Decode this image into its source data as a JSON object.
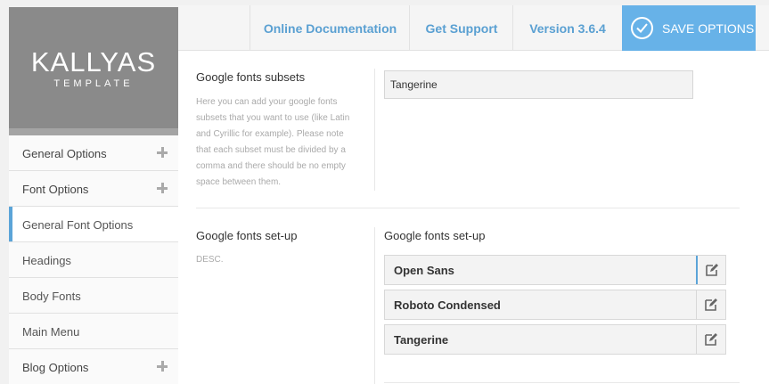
{
  "logo": {
    "title": "KALLYAS",
    "subtitle": "TEMPLATE"
  },
  "sidebar": {
    "items": [
      {
        "label": "General Options",
        "expandable": true
      },
      {
        "label": "Font Options",
        "expandable": true
      },
      {
        "label": "General Font Options",
        "active": true
      },
      {
        "label": "Headings"
      },
      {
        "label": "Body Fonts"
      },
      {
        "label": "Main Menu"
      },
      {
        "label": "Blog Options",
        "expandable": true
      }
    ]
  },
  "topbar": {
    "docs": "Online Documentation",
    "support": "Get Support",
    "version": "Version 3.6.4",
    "save": "SAVE OPTIONS"
  },
  "subsets": {
    "title": "Google fonts subsets",
    "desc_lines": [
      "Here you can add your google fonts",
      "subsets that you want to use (like Latin",
      "and Cyrillic for example). Please note",
      "that each subset must be divided by a",
      "comma and there should be no empty",
      "space between them."
    ],
    "value": "Tangerine"
  },
  "setup": {
    "title": "Google fonts set-up",
    "desc": "DESC.",
    "section_label": "Google fonts set-up",
    "fonts": [
      "Open Sans",
      "Roboto Condensed",
      "Tangerine"
    ]
  },
  "colors": {
    "accent": "#67b2e8",
    "link": "#5aa0d2"
  },
  "icons": {
    "plus": "plus-icon",
    "edit": "edit-icon",
    "check": "check-circle-icon"
  }
}
